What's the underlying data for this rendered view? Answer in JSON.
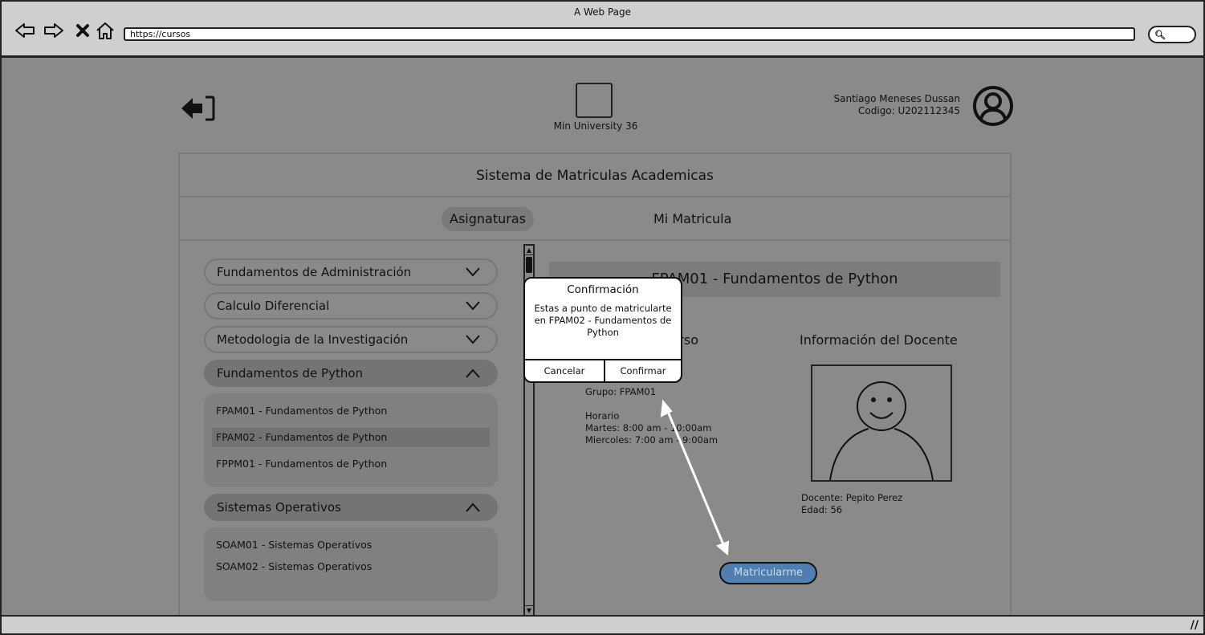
{
  "browser": {
    "window_title": "A Web Page",
    "url": "https://cursos"
  },
  "header": {
    "university_name": "Min University 36",
    "user_name": "Santiago Meneses Dussan",
    "user_code": "Codigo: U202112345"
  },
  "panel": {
    "title": "Sistema de Matriculas Academicas",
    "tabs": [
      {
        "label": "Asignaturas",
        "active": true
      },
      {
        "label": "Mi Matricula",
        "active": false
      }
    ]
  },
  "courses": [
    {
      "name": "Fundamentos de Administración",
      "expanded": false
    },
    {
      "name": "Calculo Diferencial",
      "expanded": false
    },
    {
      "name": "Metodologia de la Investigación",
      "expanded": false
    },
    {
      "name": "Fundamentos de Python",
      "expanded": true,
      "groups": [
        "FPAM01 - Fundamentos de Python",
        "FPAM02 - Fundamentos de Python",
        "FPPM01 - Fundamentos de Python"
      ],
      "selected_group": "FPAM02 - Fundamentos de Python"
    },
    {
      "name": "Sistemas Operativos",
      "expanded": true,
      "groups": [
        "SOAM01 - Sistemas Operativos",
        "SOAM02 - Sistemas Operativos"
      ]
    }
  ],
  "detail": {
    "header": "FPAM01 - Fundamentos de Python",
    "course_info_title": "Curso",
    "course_info_text": "ntos de\n\nGrupo: FPAM01\n\nHorario\nMartes: 8:00 am - 10:00am\nMiercoles: 7:00 am - 9:00am",
    "teacher_title": "Información del Docente",
    "teacher_name": "Docente: Pepito Perez",
    "teacher_age": "Edad: 56",
    "enroll_button": "Matricularme"
  },
  "dialog": {
    "title": "Confirmación",
    "message": "Estas a punto de matricularte en FPAM02 - Fundamentos de Python",
    "cancel": "Cancelar",
    "confirm": "Confirmar"
  },
  "colors": {
    "overlay": "#8a8a8a",
    "button_blue": "#4f7fb0"
  }
}
